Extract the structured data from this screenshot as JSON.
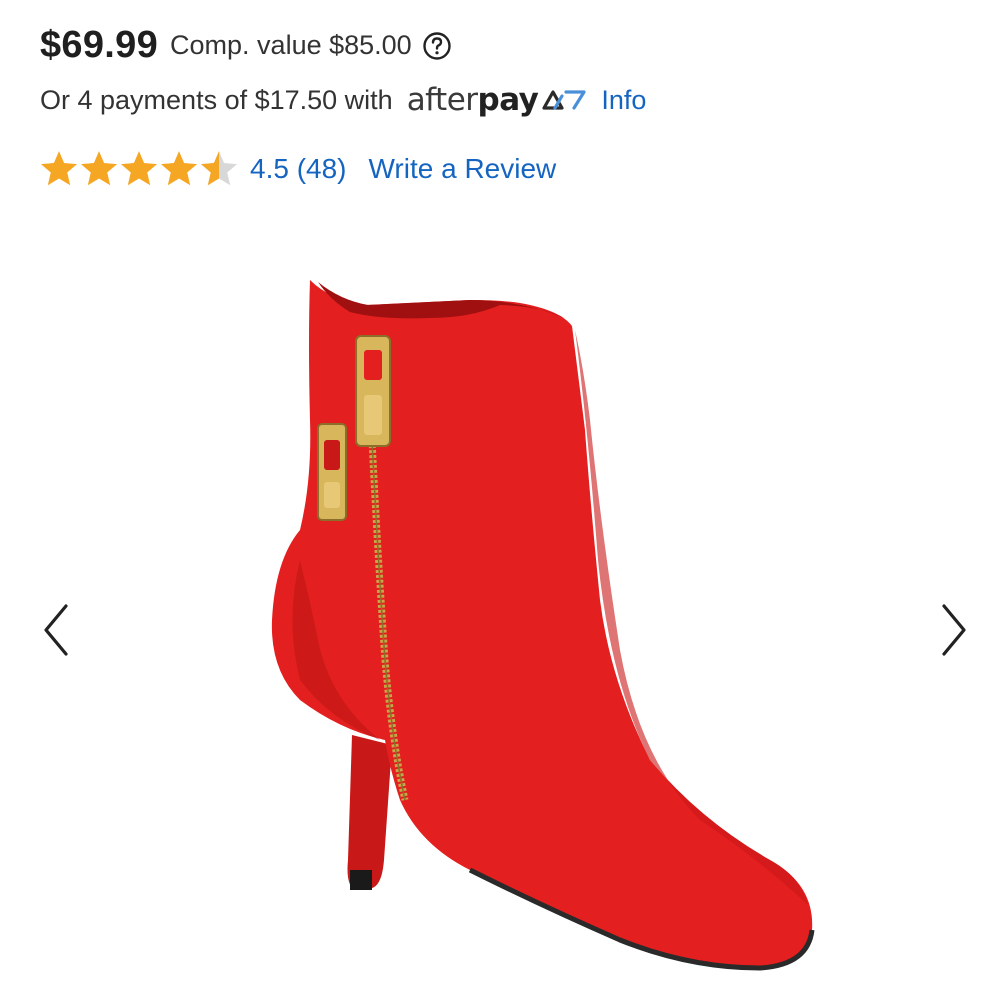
{
  "price": {
    "current": "$69.99",
    "comp_value": "Comp. value $85.00",
    "help_icon": "question-circle-icon"
  },
  "installments": {
    "text": "Or 4 payments of $17.50 with",
    "provider_logo": {
      "part1": "after",
      "part2": "pay",
      "mark_icon": "afterpay-arrows-icon",
      "accent": "#4a90d9"
    },
    "info_link": "Info"
  },
  "rating": {
    "stars": 4.5,
    "max_stars": 5,
    "summary": "4.5 (48)",
    "write_review": "Write a Review",
    "star_color": "#f5a623",
    "star_empty_color": "#d8d8d8"
  },
  "colors": {
    "link": "#1565c0",
    "product_red": "#e41f1f"
  },
  "gallery": {
    "prev_icon": "chevron-left-icon",
    "next_icon": "chevron-right-icon"
  }
}
